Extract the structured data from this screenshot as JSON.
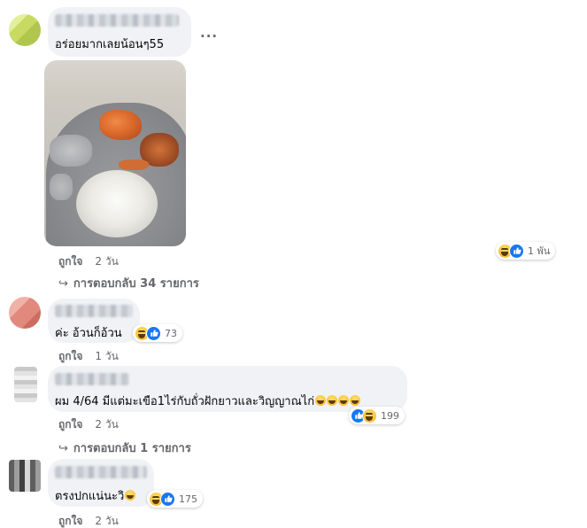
{
  "comments": [
    {
      "text": "อร่อยมากเลยน้อนๆ55",
      "more_label": "···",
      "like_action": "ถูกใจ",
      "time": "2 วัน",
      "reaction_count": "1 พัน",
      "reply_arrow": "↪",
      "replies_label": "การตอบกลับ 34 รายการ"
    },
    {
      "text": "ค่ะ อ้วนก็อ้วน",
      "like_action": "ถูกใจ",
      "time": "1 วัน",
      "reaction_count": "73"
    },
    {
      "text": "ผม 4/64 มีแต่มะเขือ1ไร่กับถั่วฝักยาวและวิญญาณไก่",
      "like_action": "ถูกใจ",
      "time": "2 วัน",
      "reaction_count": "199",
      "reply_arrow": "↪",
      "replies_label": "การตอบกลับ 1 รายการ"
    },
    {
      "text": "ตรงปกแน่นะวิ",
      "like_action": "ถูกใจ",
      "time": "2 วัน",
      "reaction_count": "175"
    }
  ],
  "icons": {
    "reactions": [
      "haha-reaction-icon",
      "like-reaction-icon"
    ],
    "inline_emoji": "laughing-emoji-icon"
  },
  "colors": {
    "bubble": "#f0f2f5",
    "meta_text": "#65676b",
    "like_blue": "#1877f2",
    "haha_yellow": "#f7b125"
  }
}
